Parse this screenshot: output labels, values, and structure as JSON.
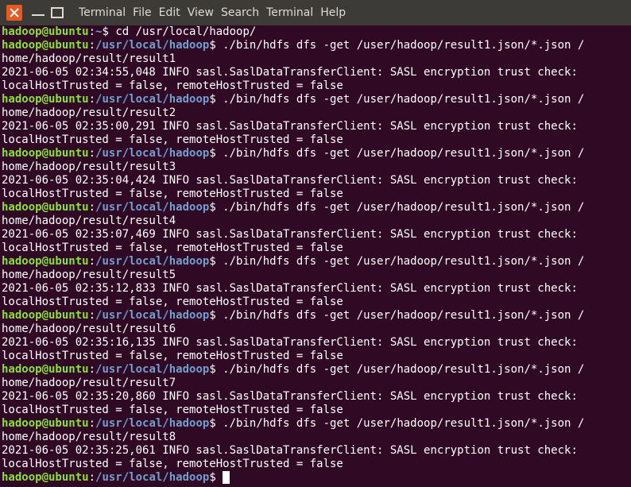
{
  "menu": [
    "Terminal",
    "File",
    "Edit",
    "View",
    "Search",
    "Terminal",
    "Help"
  ],
  "prompt": {
    "user": "hadoop@ubuntu",
    "home": "~",
    "path": "/usr/local/hadoop",
    "suffix": "$ "
  },
  "lines": [
    {
      "type": "prompt",
      "path": "~",
      "cmd": "cd /usr/local/hadoop/"
    },
    {
      "type": "prompt",
      "path": "/usr/local/hadoop",
      "cmd": "./bin/hdfs dfs -get /user/hadoop/result1.json/*.json /"
    },
    {
      "type": "out",
      "text": "home/hadoop/result/result1"
    },
    {
      "type": "out",
      "text": "2021-06-05 02:34:55,048 INFO sasl.SaslDataTransferClient: SASL encryption trust check:"
    },
    {
      "type": "out",
      "text": "localHostTrusted = false, remoteHostTrusted = false"
    },
    {
      "type": "prompt",
      "path": "/usr/local/hadoop",
      "cmd": "./bin/hdfs dfs -get /user/hadoop/result1.json/*.json /"
    },
    {
      "type": "out",
      "text": "home/hadoop/result/result2"
    },
    {
      "type": "out",
      "text": "2021-06-05 02:35:00,291 INFO sasl.SaslDataTransferClient: SASL encryption trust check:"
    },
    {
      "type": "out",
      "text": "localHostTrusted = false, remoteHostTrusted = false"
    },
    {
      "type": "prompt",
      "path": "/usr/local/hadoop",
      "cmd": "./bin/hdfs dfs -get /user/hadoop/result1.json/*.json /"
    },
    {
      "type": "out",
      "text": "home/hadoop/result/result3"
    },
    {
      "type": "out",
      "text": "2021-06-05 02:35:04,424 INFO sasl.SaslDataTransferClient: SASL encryption trust check:"
    },
    {
      "type": "out",
      "text": "localHostTrusted = false, remoteHostTrusted = false"
    },
    {
      "type": "prompt",
      "path": "/usr/local/hadoop",
      "cmd": "./bin/hdfs dfs -get /user/hadoop/result1.json/*.json /"
    },
    {
      "type": "out",
      "text": "home/hadoop/result/result4"
    },
    {
      "type": "out",
      "text": "2021-06-05 02:35:07,469 INFO sasl.SaslDataTransferClient: SASL encryption trust check:"
    },
    {
      "type": "out",
      "text": "localHostTrusted = false, remoteHostTrusted = false"
    },
    {
      "type": "prompt",
      "path": "/usr/local/hadoop",
      "cmd": "./bin/hdfs dfs -get /user/hadoop/result1.json/*.json /"
    },
    {
      "type": "out",
      "text": "home/hadoop/result/result5"
    },
    {
      "type": "out",
      "text": "2021-06-05 02:35:12,833 INFO sasl.SaslDataTransferClient: SASL encryption trust check:"
    },
    {
      "type": "out",
      "text": "localHostTrusted = false, remoteHostTrusted = false"
    },
    {
      "type": "prompt",
      "path": "/usr/local/hadoop",
      "cmd": "./bin/hdfs dfs -get /user/hadoop/result1.json/*.json /"
    },
    {
      "type": "out",
      "text": "home/hadoop/result/result6"
    },
    {
      "type": "out",
      "text": "2021-06-05 02:35:16,135 INFO sasl.SaslDataTransferClient: SASL encryption trust check:"
    },
    {
      "type": "out",
      "text": "localHostTrusted = false, remoteHostTrusted = false"
    },
    {
      "type": "prompt",
      "path": "/usr/local/hadoop",
      "cmd": "./bin/hdfs dfs -get /user/hadoop/result1.json/*.json /"
    },
    {
      "type": "out",
      "text": "home/hadoop/result/result7"
    },
    {
      "type": "out",
      "text": "2021-06-05 02:35:20,860 INFO sasl.SaslDataTransferClient: SASL encryption trust check:"
    },
    {
      "type": "out",
      "text": "localHostTrusted = false, remoteHostTrusted = false"
    },
    {
      "type": "prompt",
      "path": "/usr/local/hadoop",
      "cmd": "./bin/hdfs dfs -get /user/hadoop/result1.json/*.json /"
    },
    {
      "type": "out",
      "text": "home/hadoop/result/result8"
    },
    {
      "type": "out",
      "text": "2021-06-05 02:35:25,061 INFO sasl.SaslDataTransferClient: SASL encryption trust check:"
    },
    {
      "type": "out",
      "text": "localHostTrusted = false, remoteHostTrusted = false"
    },
    {
      "type": "prompt",
      "path": "/usr/local/hadoop",
      "cmd": "",
      "cursor": true
    }
  ],
  "icons": {
    "close": "close-icon",
    "minimize": "minimize-icon",
    "maximize": "maximize-icon"
  },
  "colors": {
    "background": "#300a24",
    "titlebar": "#3c3b37",
    "close_button": "#e9591f",
    "prompt_user": "#8ae234",
    "prompt_path": "#729fcf",
    "text": "#ffffff"
  }
}
